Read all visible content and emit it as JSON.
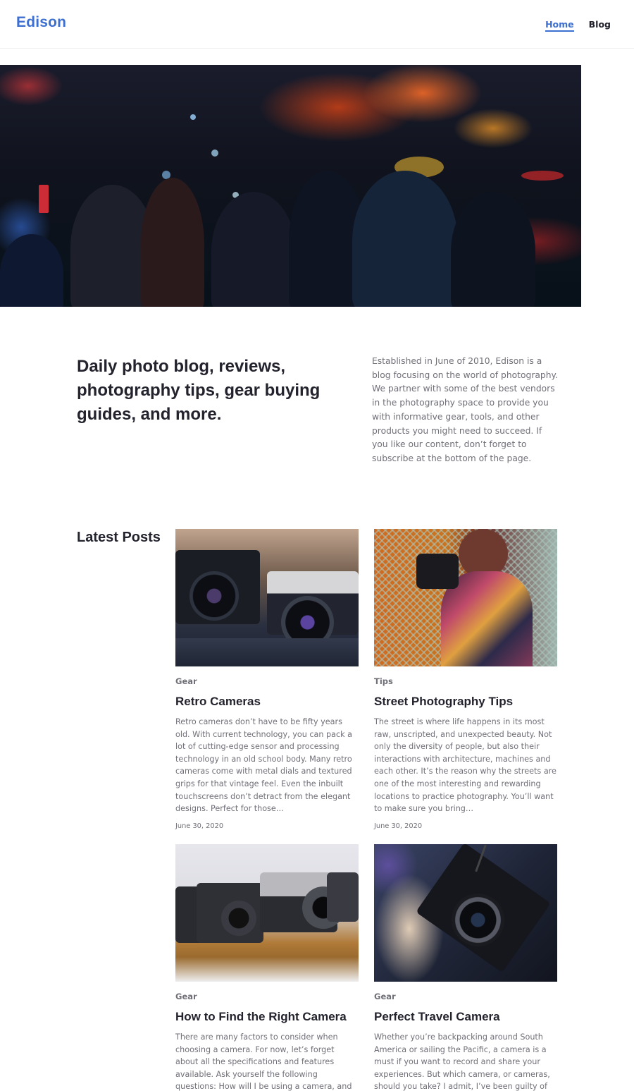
{
  "header": {
    "logo": "Edison",
    "nav": [
      {
        "label": "Home",
        "active": true
      },
      {
        "label": "Blog",
        "active": false
      }
    ]
  },
  "intro": {
    "heading": "Daily photo blog, reviews, photography tips, gear buying guides, and more.",
    "description": "Established in June of 2010, Edison is a blog focusing on the world of photography. We partner with some of the best vendors in the photography space to provide you with informative gear, tools, and other products you might need to succeed. If you like our content, don’t forget to subscribe at the bottom of the page."
  },
  "latest": {
    "title": "Latest Posts",
    "posts": [
      {
        "category": "Gear",
        "title": "Retro Cameras",
        "excerpt": "Retro cameras don’t have to be fifty years old. With current technology, you can pack a lot of cutting-edge sensor and processing technology in an old school body. Many retro cameras come with metal dials and textured grips for that vintage feel. Even the inbuilt touchscreens don’t detract from the elegant designs. Perfect for those…",
        "date": "June 30, 2020"
      },
      {
        "category": "Tips",
        "title": "Street Photography Tips",
        "excerpt": "The street is where life happens in its most raw, unscripted, and unexpected beauty. Not only the diversity of people, but also their interactions with architecture, machines and each other. It’s the reason why the streets are one of the most interesting and rewarding locations to practice photography. You’ll want to make sure you bring…",
        "date": "June 30, 2020"
      },
      {
        "category": "Gear",
        "title": "How to Find the Right Camera",
        "excerpt": "There are many factors to consider when choosing a camera. For now, let’s forget about all the specifications and features available. Ask yourself the following questions: How will I be using a camera, and how often? What do I want",
        "date": ""
      },
      {
        "category": "Gear",
        "title": "Perfect Travel Camera",
        "excerpt": "Whether you’re backpacking around South America or sailing the Pacific, a camera is a must if you want to record and share your experiences. But which camera, or cameras, should you take? I admit, I’ve been guilty of both",
        "date": ""
      }
    ]
  },
  "colors": {
    "accent": "#3d6fd1",
    "heading": "#23232e",
    "body_text": "#6f6f78"
  }
}
